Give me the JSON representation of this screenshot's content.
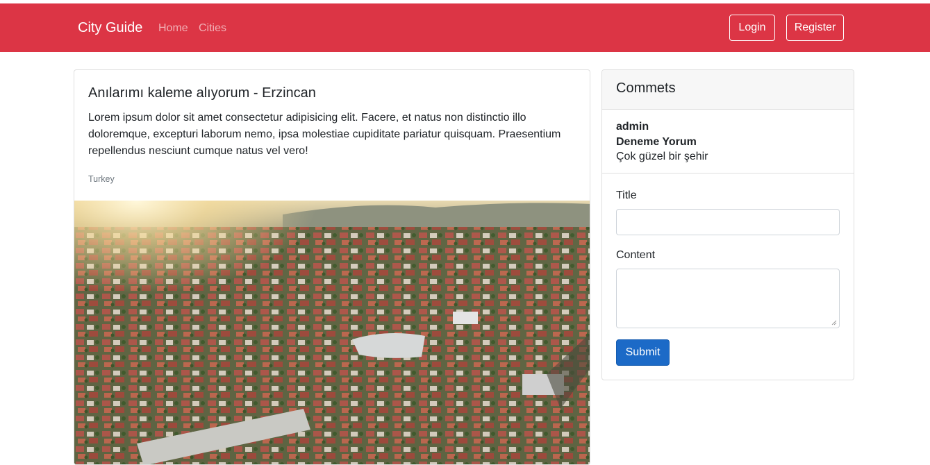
{
  "navbar": {
    "brand": "City Guide",
    "links": [
      "Home",
      "Cities"
    ],
    "login_label": "Login",
    "register_label": "Register",
    "color": "#dc3545"
  },
  "post": {
    "title": "Anılarımı kaleme alıyorum - Erzincan",
    "body": "Lorem ipsum dolor sit amet consectetur adipisicing elit. Facere, et natus non distinctio illo doloremque, excepturi laborum nemo, ipsa molestiae cupiditate pariatur quisquam. Praesentium repellendus nesciunt cumque natus vel vero!",
    "country": "Turkey",
    "image": "aerial-city-photo"
  },
  "comments_panel": {
    "header": "Commets",
    "comments": [
      {
        "user": "admin",
        "title": "Deneme Yorum",
        "content": "Çok güzel bir şehir"
      }
    ],
    "form": {
      "title_label": "Title",
      "title_value": "",
      "content_label": "Content",
      "content_value": "",
      "submit_label": "Submit",
      "submit_color": "#1c6ac7"
    }
  }
}
